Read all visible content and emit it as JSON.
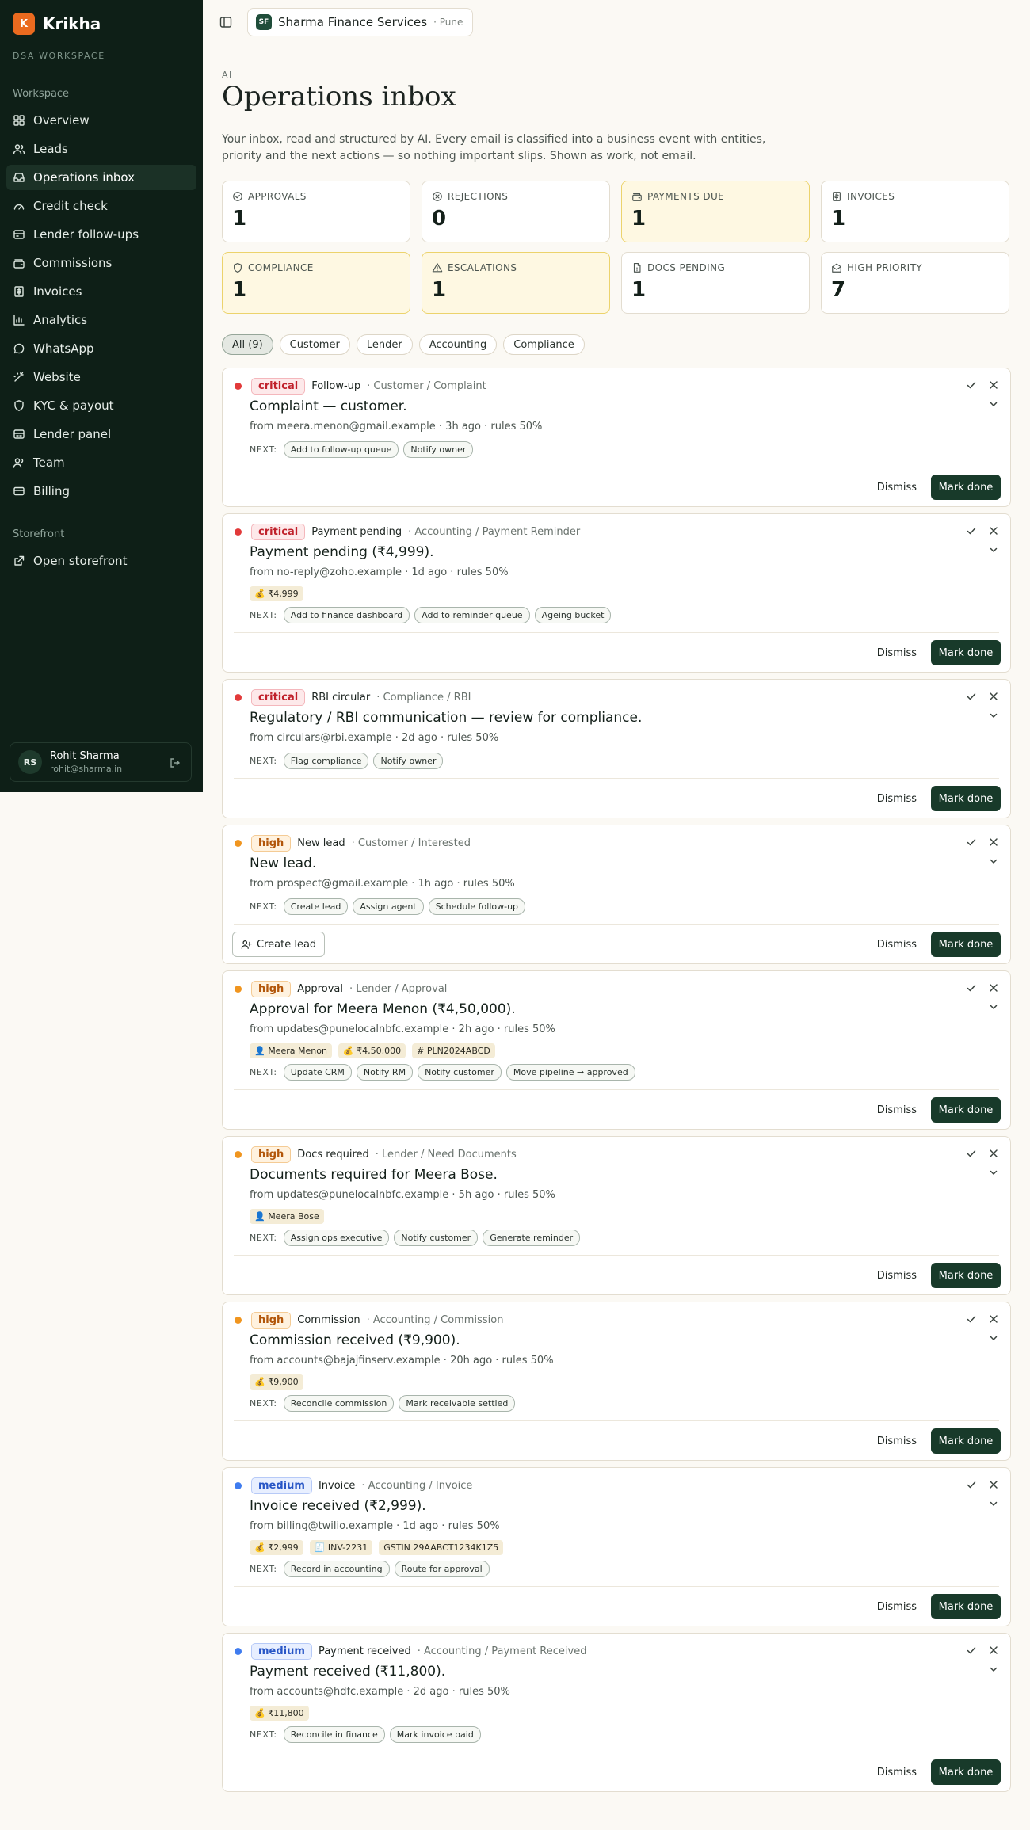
{
  "brand": {
    "logo": "K",
    "name": "Krikha",
    "workspace_label": "DSA WORKSPACE"
  },
  "sidebar": {
    "workspace_label": "Workspace",
    "items": [
      {
        "label": "Overview",
        "icon": "grid-icon"
      },
      {
        "label": "Leads",
        "icon": "users-icon"
      },
      {
        "label": "Operations inbox",
        "icon": "inbox-icon"
      },
      {
        "label": "Credit check",
        "icon": "gauge-icon"
      },
      {
        "label": "Lender follow-ups",
        "icon": "bank-icon"
      },
      {
        "label": "Commissions",
        "icon": "wallet-icon"
      },
      {
        "label": "Invoices",
        "icon": "invoice-icon"
      },
      {
        "label": "Analytics",
        "icon": "chart-icon"
      },
      {
        "label": "WhatsApp",
        "icon": "chat-icon"
      },
      {
        "label": "Website",
        "icon": "wand-icon"
      },
      {
        "label": "KYC & payout",
        "icon": "shield-icon"
      },
      {
        "label": "Lender panel",
        "icon": "panel-icon"
      },
      {
        "label": "Team",
        "icon": "team-icon"
      },
      {
        "label": "Billing",
        "icon": "card-icon"
      }
    ],
    "storefront_label": "Storefront",
    "storefront_items": [
      {
        "label": "Open storefront",
        "icon": "external-link-icon"
      }
    ]
  },
  "user": {
    "initials": "RS",
    "name": "Rohit Sharma",
    "email": "rohit@sharma.in"
  },
  "topbar": {
    "org_initials": "SF",
    "org_name": "Sharma Finance Services",
    "org_city": "· Pune"
  },
  "page": {
    "eyebrow": "AI",
    "title": "Operations inbox",
    "description": "Your inbox, read and structured by AI. Every email is classified into a business event with entities, priority and the next actions — so nothing important slips. Shown as work, not email."
  },
  "stats": [
    {
      "label": "APPROVALS",
      "value": "1",
      "icon": "check-circle-icon",
      "highlight": false
    },
    {
      "label": "REJECTIONS",
      "value": "0",
      "icon": "x-circle-icon",
      "highlight": false
    },
    {
      "label": "PAYMENTS DUE",
      "value": "1",
      "icon": "wallet-icon",
      "highlight": true
    },
    {
      "label": "INVOICES",
      "value": "1",
      "icon": "invoice-icon",
      "highlight": false
    },
    {
      "label": "COMPLIANCE",
      "value": "1",
      "icon": "shield-icon",
      "highlight": true
    },
    {
      "label": "ESCALATIONS",
      "value": "1",
      "icon": "alert-icon",
      "highlight": true
    },
    {
      "label": "DOCS PENDING",
      "value": "1",
      "icon": "file-icon",
      "highlight": false
    },
    {
      "label": "HIGH PRIORITY",
      "value": "7",
      "icon": "mail-open-icon",
      "highlight": false
    }
  ],
  "filters": [
    "All (9)",
    "Customer",
    "Lender",
    "Accounting",
    "Compliance"
  ],
  "cards": [
    {
      "priority": "critical",
      "event": "Follow-up",
      "category": "· Customer / Complaint",
      "title": "Complaint — customer.",
      "from": "from meera.menon@gmail.example  · 3h ago  · rules 50%",
      "chips": [],
      "next_label": "NEXT:",
      "next": [
        "Add to follow-up queue",
        "Notify owner"
      ],
      "create_lead": false,
      "dismiss": "Dismiss",
      "done": "Mark done"
    },
    {
      "priority": "critical",
      "event": "Payment pending",
      "category": "· Accounting / Payment Reminder",
      "title": "Payment pending (₹4,999).",
      "from": "from no-reply@zoho.example  · 1d ago  · rules 50%",
      "chips": [
        "💰 ₹4,999"
      ],
      "next_label": "NEXT:",
      "next": [
        "Add to finance dashboard",
        "Add to reminder queue",
        "Ageing bucket"
      ],
      "create_lead": false,
      "dismiss": "Dismiss",
      "done": "Mark done"
    },
    {
      "priority": "critical",
      "event": "RBI circular",
      "category": "· Compliance / RBI",
      "title": "Regulatory / RBI communication — review for compliance.",
      "from": "from circulars@rbi.example  · 2d ago  · rules 50%",
      "chips": [],
      "next_label": "NEXT:",
      "next": [
        "Flag compliance",
        "Notify owner"
      ],
      "create_lead": false,
      "dismiss": "Dismiss",
      "done": "Mark done"
    },
    {
      "priority": "high",
      "event": "New lead",
      "category": "· Customer / Interested",
      "title": "New lead.",
      "from": "from prospect@gmail.example  · 1h ago  · rules 50%",
      "chips": [],
      "next_label": "NEXT:",
      "next": [
        "Create lead",
        "Assign agent",
        "Schedule follow-up"
      ],
      "create_lead": true,
      "create_lead_label": "Create lead",
      "dismiss": "Dismiss",
      "done": "Mark done"
    },
    {
      "priority": "high",
      "event": "Approval",
      "category": "· Lender / Approval",
      "title": "Approval for Meera Menon (₹4,50,000).",
      "from": "from updates@punelocalnbfc.example  · 2h ago  · rules 50%",
      "chips": [
        "👤 Meera Menon",
        "💰 ₹4,50,000",
        "# PLN2024ABCD"
      ],
      "next_label": "NEXT:",
      "next": [
        "Update CRM",
        "Notify RM",
        "Notify customer",
        "Move pipeline → approved"
      ],
      "create_lead": false,
      "dismiss": "Dismiss",
      "done": "Mark done"
    },
    {
      "priority": "high",
      "event": "Docs required",
      "category": "· Lender / Need Documents",
      "title": "Documents required for Meera Bose.",
      "from": "from updates@punelocalnbfc.example  · 5h ago  · rules 50%",
      "chips": [
        "👤 Meera Bose"
      ],
      "next_label": "NEXT:",
      "next": [
        "Assign ops executive",
        "Notify customer",
        "Generate reminder"
      ],
      "create_lead": false,
      "dismiss": "Dismiss",
      "done": "Mark done"
    },
    {
      "priority": "high",
      "event": "Commission",
      "category": "· Accounting / Commission",
      "title": "Commission received (₹9,900).",
      "from": "from accounts@bajajfinserv.example  · 20h ago  · rules 50%",
      "chips": [
        "💰 ₹9,900"
      ],
      "next_label": "NEXT:",
      "next": [
        "Reconcile commission",
        "Mark receivable settled"
      ],
      "create_lead": false,
      "dismiss": "Dismiss",
      "done": "Mark done"
    },
    {
      "priority": "medium",
      "event": "Invoice",
      "category": "· Accounting / Invoice",
      "title": "Invoice received (₹2,999).",
      "from": "from billing@twilio.example  · 1d ago  · rules 50%",
      "chips": [
        "💰 ₹2,999",
        "🧾 INV-2231",
        "GSTIN 29AABCT1234K1Z5"
      ],
      "next_label": "NEXT:",
      "next": [
        "Record in accounting",
        "Route for approval"
      ],
      "create_lead": false,
      "dismiss": "Dismiss",
      "done": "Mark done"
    },
    {
      "priority": "medium",
      "event": "Payment received",
      "category": "· Accounting / Payment Received",
      "title": "Payment received (₹11,800).",
      "from": "from accounts@hdfc.example  · 2d ago  · rules 50%",
      "chips": [
        "💰 ₹11,800"
      ],
      "next_label": "NEXT:",
      "next": [
        "Reconcile in finance",
        "Mark invoice paid"
      ],
      "create_lead": false,
      "dismiss": "Dismiss",
      "done": "Mark done"
    }
  ]
}
